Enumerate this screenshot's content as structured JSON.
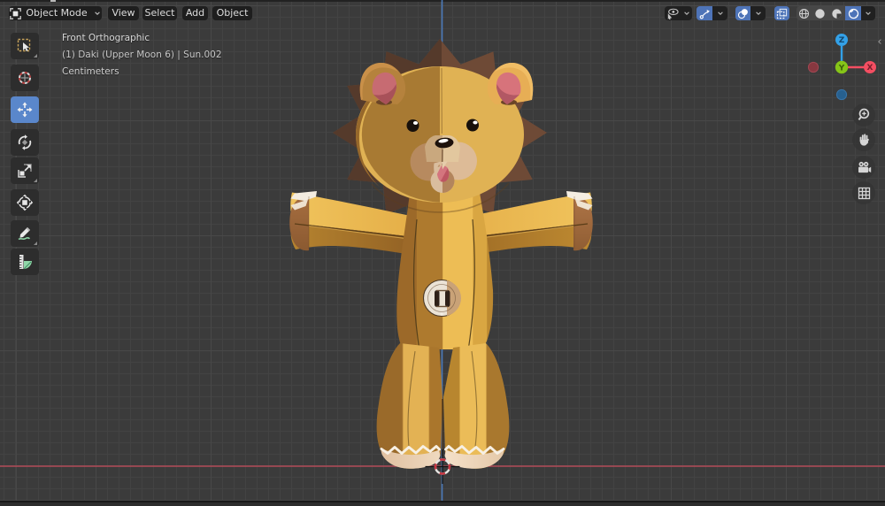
{
  "app": "blender-3d-viewport",
  "header": {
    "mode_selector": {
      "label": "Object Mode",
      "icon": "object-mode-icon"
    },
    "menus": [
      {
        "label": "View"
      },
      {
        "label": "Select"
      },
      {
        "label": "Add"
      },
      {
        "label": "Object"
      }
    ],
    "right_controls": {
      "visibility": {
        "icon": "eye-pointer-icon",
        "has_dropdown": true,
        "active": false
      },
      "gizmos": {
        "icon": "gizmo-icon",
        "has_dropdown": true,
        "active": true
      },
      "overlays": {
        "icon": "overlays-icon",
        "has_dropdown": true,
        "active": true
      },
      "xray": {
        "icon": "xray-icon",
        "active": true
      },
      "shading": {
        "modes": [
          "wireframe",
          "solid",
          "material-preview",
          "rendered"
        ],
        "active": "rendered",
        "has_dropdown": true
      }
    }
  },
  "toolbar": {
    "tools": [
      {
        "name": "select-box",
        "active": false
      },
      {
        "name": "cursor",
        "active": false
      },
      {
        "name": "move",
        "active": true
      },
      {
        "name": "rotate",
        "active": false
      },
      {
        "name": "scale",
        "active": false
      },
      {
        "name": "transform",
        "active": false
      },
      {
        "name": "annotate",
        "active": false
      },
      {
        "name": "measure",
        "active": false
      }
    ]
  },
  "viewport": {
    "overlay_text": {
      "view_name": "Front Orthographic",
      "active_object": "(1) Daki (Upper Moon 6) | Sun.002",
      "units": "Centimeters"
    },
    "axis_gizmo": {
      "x_label": "X",
      "y_label": "Y",
      "z_label": "Z"
    },
    "nav_buttons": [
      "zoom",
      "pan",
      "camera-view",
      "toggle-perspective"
    ],
    "scene_object": "lion-plush-toy",
    "colors": {
      "accent_blue": "#4e74b8",
      "toolbar_active_blue": "#5a87cb",
      "axis_x_red": "#b24b57",
      "axis_z_blue": "#4a79b8",
      "gizmo_x": "#f44e62",
      "gizmo_y": "#86c518",
      "gizmo_z": "#33a1e8",
      "background": "#3b3b3b"
    }
  }
}
